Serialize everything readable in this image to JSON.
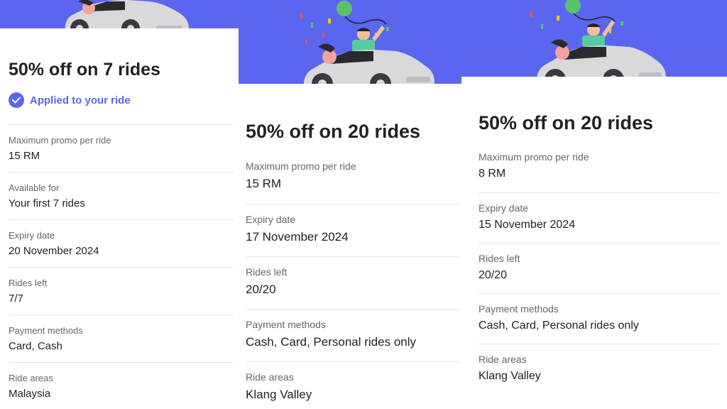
{
  "colors": {
    "accent": "#5a66f0",
    "background": "#ffffff",
    "car": "#d9d9dc"
  },
  "cards": [
    {
      "title": "50% off on 7 rides",
      "status": "Applied to your ride",
      "icon": "check-circle-icon",
      "rows": [
        {
          "label": "Maximum promo per ride",
          "value": "15 RM"
        },
        {
          "label": "Available for",
          "value": "Your first 7 rides"
        },
        {
          "label": "Expiry date",
          "value": "20 November 2024"
        },
        {
          "label": "Rides left",
          "value": "7/7"
        },
        {
          "label": "Payment methods",
          "value": "Card, Cash"
        },
        {
          "label": "Ride areas",
          "value": "Malaysia"
        }
      ]
    },
    {
      "title": "50% off on 20 rides",
      "rows": [
        {
          "label": "Maximum promo per ride",
          "value": "15 RM"
        },
        {
          "label": "Expiry date",
          "value": "17 November 2024"
        },
        {
          "label": "Rides left",
          "value": "20/20"
        },
        {
          "label": "Payment methods",
          "value": "Cash, Card, Personal rides only"
        },
        {
          "label": "Ride areas",
          "value": "Klang Valley"
        }
      ]
    },
    {
      "title": "50% off on 20 rides",
      "rows": [
        {
          "label": "Maximum promo per ride",
          "value": "8 RM"
        },
        {
          "label": "Expiry date",
          "value": "15 November 2024"
        },
        {
          "label": "Rides left",
          "value": "20/20"
        },
        {
          "label": "Payment methods",
          "value": "Cash, Card, Personal rides only"
        },
        {
          "label": "Ride areas",
          "value": "Klang Valley"
        }
      ]
    }
  ],
  "illustration": {
    "icon": "car-celebration-illustration"
  }
}
